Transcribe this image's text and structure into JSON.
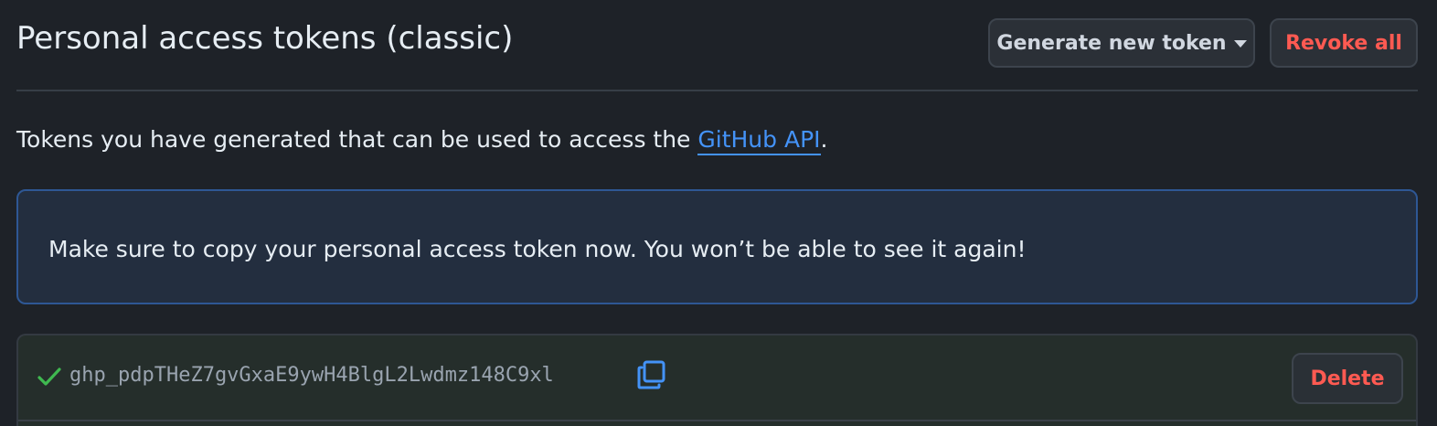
{
  "header": {
    "title": "Personal access tokens (classic)",
    "generate_button": "Generate new token",
    "revoke_all_button": "Revoke all"
  },
  "description": {
    "prefix": "Tokens you have generated that can be used to access the ",
    "link_text": "GitHub API",
    "suffix": "."
  },
  "notice": {
    "text": "Make sure to copy your personal access token now. You won’t be able to see it again!"
  },
  "token": {
    "value": "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",
    "delete_button": "Delete"
  },
  "colors": {
    "accent_link": "#4493f8",
    "danger": "#ff5a52",
    "success": "#3fb950",
    "notice_border": "#2e5794"
  },
  "icons": {
    "check": "check-icon",
    "copy": "copy-icon",
    "caret": "caret-down-icon"
  }
}
